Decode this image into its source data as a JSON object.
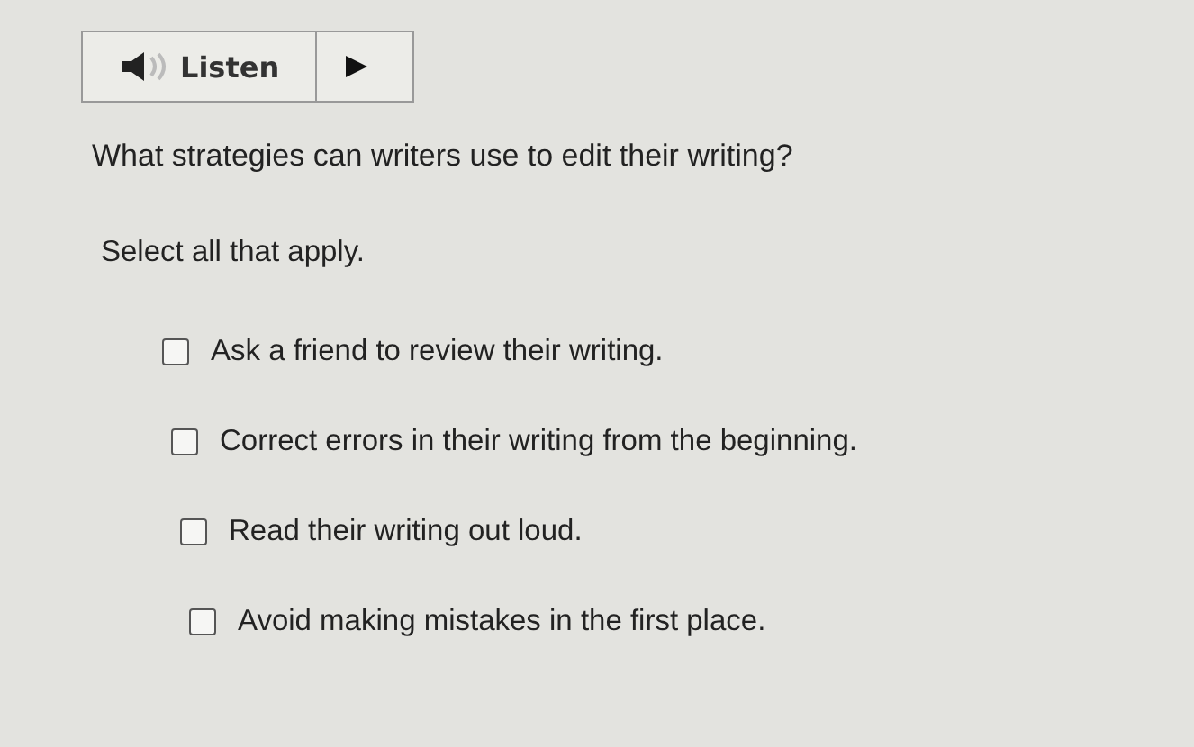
{
  "listen_button": {
    "label": "Listen"
  },
  "question": "What strategies can writers use to edit their writing?",
  "instruction": "Select all that apply.",
  "options": [
    {
      "label": "Ask a friend to review their writing.",
      "checked": false
    },
    {
      "label": "Correct errors in their writing from the beginning.",
      "checked": false
    },
    {
      "label": "Read their writing out loud.",
      "checked": false
    },
    {
      "label": "Avoid making mistakes in the first place.",
      "checked": false
    }
  ]
}
